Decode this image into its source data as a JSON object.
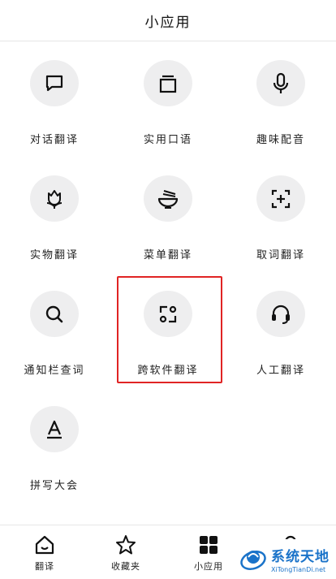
{
  "header": {
    "title": "小应用"
  },
  "apps": [
    {
      "label": "对话翻译",
      "icon": "chat-bubble-icon"
    },
    {
      "label": "实用口语",
      "icon": "square-stack-icon"
    },
    {
      "label": "趣味配音",
      "icon": "microphone-icon"
    },
    {
      "label": "实物翻译",
      "icon": "flower-icon"
    },
    {
      "label": "菜单翻译",
      "icon": "noodle-bowl-icon"
    },
    {
      "label": "取词翻译",
      "icon": "scan-plus-icon"
    },
    {
      "label": "通知栏查词",
      "icon": "search-icon"
    },
    {
      "label": "跨软件翻译",
      "icon": "cross-app-icon"
    },
    {
      "label": "人工翻译",
      "icon": "headset-icon"
    },
    {
      "label": "拼写大会",
      "icon": "letter-a-icon"
    }
  ],
  "tabbar": {
    "tabs": [
      {
        "label": "翻译",
        "icon": "home-icon"
      },
      {
        "label": "收藏夹",
        "icon": "star-icon"
      },
      {
        "label": "小应用",
        "icon": "grid-icon",
        "active": true
      }
    ]
  },
  "watermark": {
    "cn": "系统天地",
    "en": "XiTongTianDi.net"
  },
  "colors": {
    "highlight": "#e02424",
    "circle_bg": "#eeeeef",
    "watermark": "#1a73c9"
  }
}
